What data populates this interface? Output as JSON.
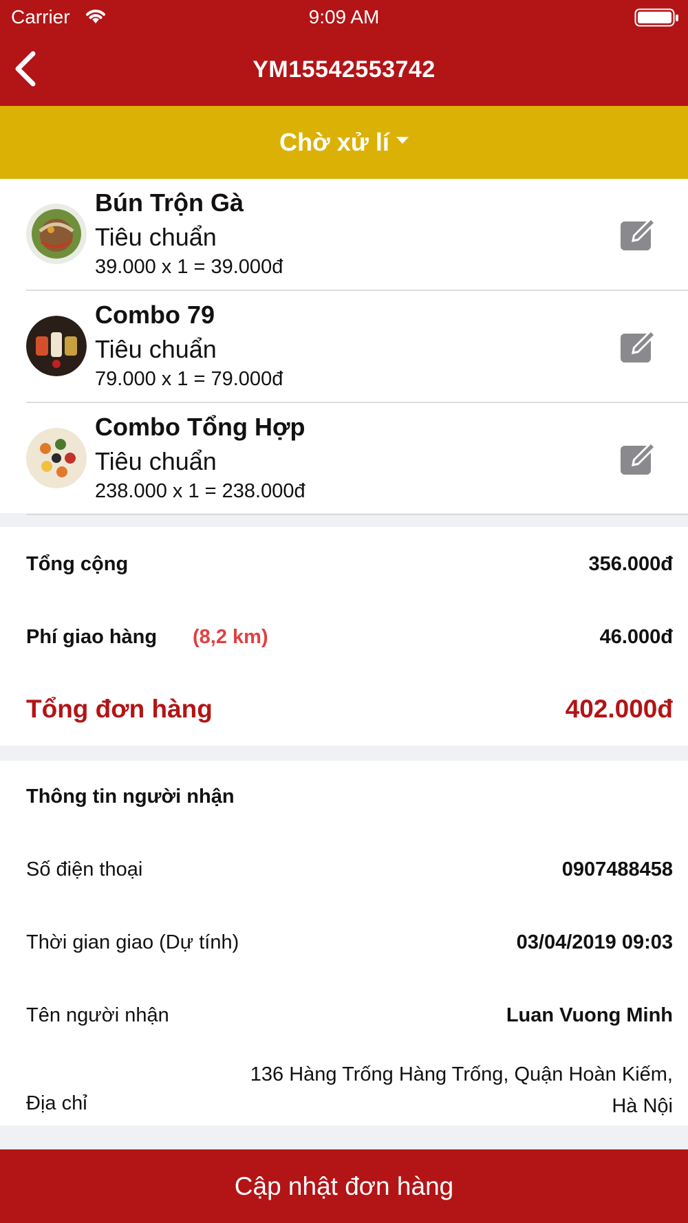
{
  "status_bar": {
    "carrier": "Carrier",
    "time": "9:09 AM"
  },
  "nav": {
    "title": "YM15542553742",
    "back_icon": "chevron-left-icon"
  },
  "order_status": {
    "label": "Chờ xử lí",
    "icon": "caret-down-icon",
    "color": "#dcb106"
  },
  "items": [
    {
      "name": "Bún Trộn Gà",
      "variant": "Tiêu chuẩn",
      "price_line": "39.000 x 1 = 39.000đ",
      "edit_icon": "edit-icon"
    },
    {
      "name": "Combo 79",
      "variant": "Tiêu chuẩn",
      "price_line": "79.000 x 1 = 79.000đ",
      "edit_icon": "edit-icon"
    },
    {
      "name": "Combo Tổng Hợp",
      "variant": "Tiêu chuẩn",
      "price_line": "238.000 x 1 = 238.000đ",
      "edit_icon": "edit-icon"
    }
  ],
  "totals": {
    "subtotal_label": "Tổng cộng",
    "subtotal_value": "356.000đ",
    "shipping_label": "Phí giao hàng",
    "shipping_distance": "(8,2 km)",
    "shipping_value": "46.000đ",
    "grand_total_label": "Tổng đơn hàng",
    "grand_total_value": "402.000đ"
  },
  "recipient": {
    "section_title": "Thông tin người nhận",
    "phone_label": "Số điện thoại",
    "phone_value": "0907488458",
    "time_label": "Thời gian giao (Dự tính)",
    "time_value": "03/04/2019 09:03",
    "name_label": "Tên người nhận",
    "name_value": "Luan Vuong Minh",
    "address_label": "Địa chỉ",
    "address_line1": "136 Hàng Trống Hàng Trống, Quận Hoàn Kiếm,",
    "address_line2": "Hà Nội"
  },
  "actions": {
    "update_label": "Cập nhật đơn hàng"
  },
  "colors": {
    "primary": "#b31416",
    "accent_status": "#dcb106",
    "distance_red": "#e04040"
  }
}
